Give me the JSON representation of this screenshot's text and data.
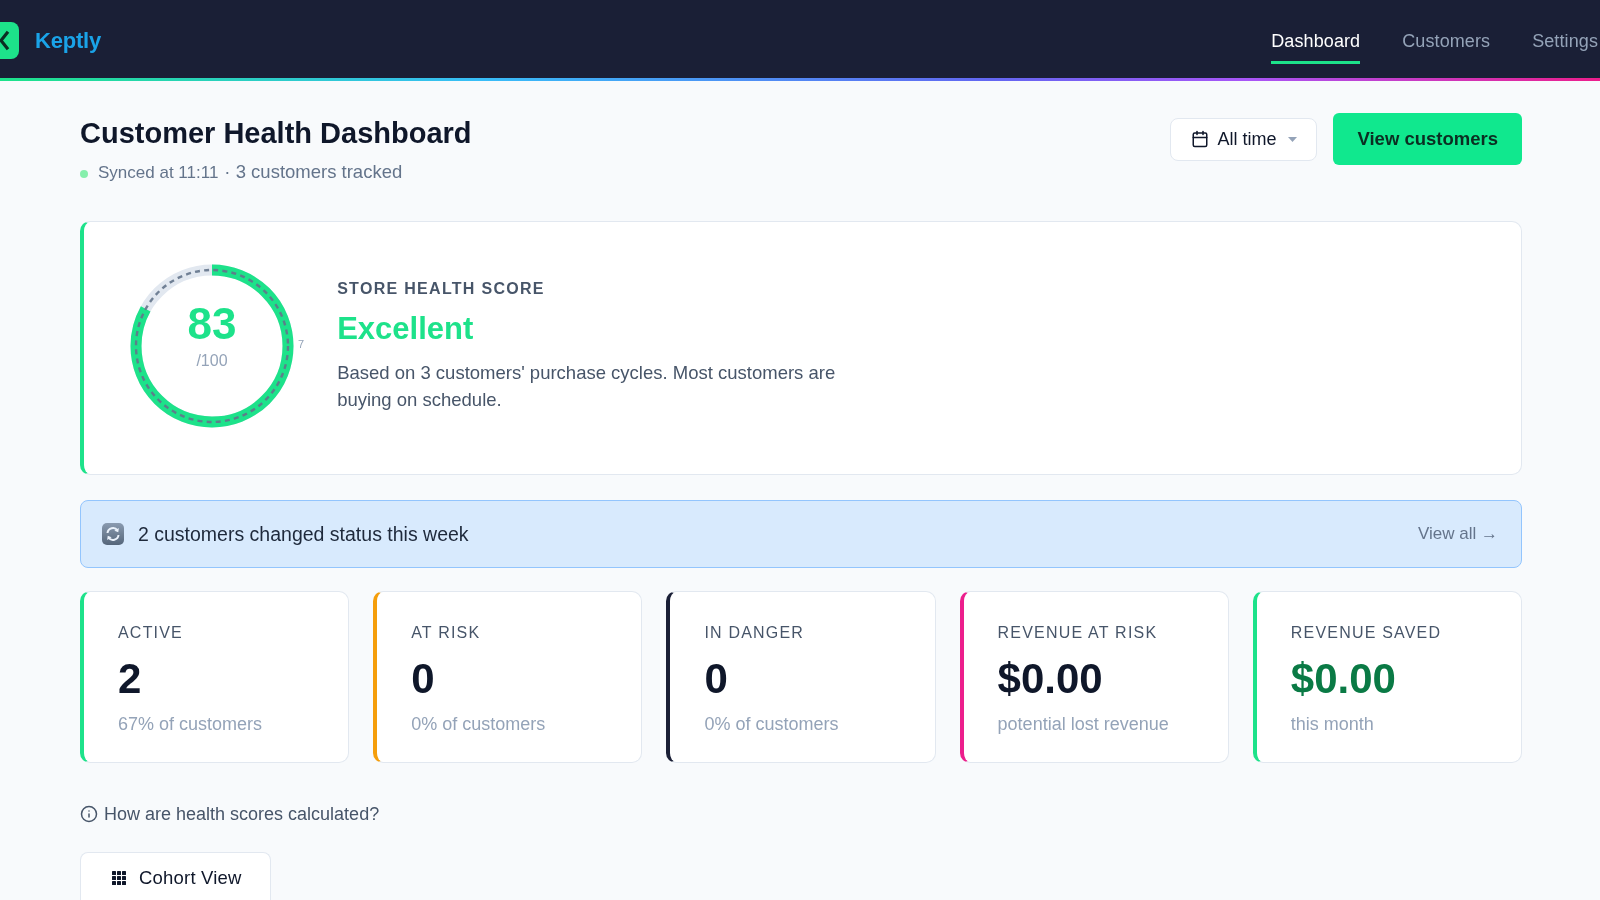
{
  "header": {
    "brand": "Keptly",
    "nav": [
      {
        "label": "Dashboard",
        "selected": true
      },
      {
        "label": "Customers",
        "selected": false
      },
      {
        "label": "Settings",
        "selected": false
      }
    ]
  },
  "page": {
    "title": "Customer Health Dashboard",
    "sync_status": "Synced at 11:11",
    "summary": "· 3 customers tracked",
    "period_filter": "All time",
    "primary_action": "View customers"
  },
  "health_card": {
    "score": "83",
    "score_max": "/100",
    "level": 0.83,
    "gauge_side_label": "7",
    "eyebrow": "STORE HEALTH SCORE",
    "rating": "Excellent",
    "description": "Based on 3 customers' purchase cycles. Most customers are buying on schedule."
  },
  "banner": {
    "message": "2 customers changed status this week",
    "link": "View all →"
  },
  "stats": [
    {
      "label": "ACTIVE",
      "value": "2",
      "note": "67% of customers",
      "color": "#1de28a",
      "positive": false
    },
    {
      "label": "AT RISK",
      "value": "0",
      "note": "0% of customers",
      "color": "#f59e0b",
      "positive": false
    },
    {
      "label": "IN DANGER",
      "value": "0",
      "note": "0% of customers",
      "color": "#1a1f36",
      "positive": false
    },
    {
      "label": "REVENUE AT RISK",
      "value": "$0.00",
      "note": "potential lost revenue",
      "color": "#ec1e8c",
      "positive": false
    },
    {
      "label": "REVENUE SAVED",
      "value": "$0.00",
      "note": "this month",
      "color": "#1de28a",
      "positive": true
    }
  ],
  "help_link": "How are health scores calculated?",
  "cohort_button": "Cohort View"
}
